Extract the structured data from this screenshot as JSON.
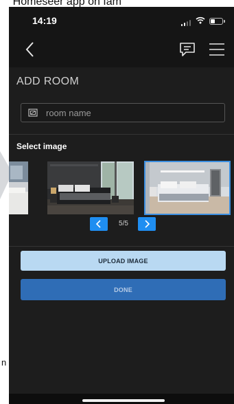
{
  "page_caption": "or Homeseer app on Iam",
  "status": {
    "time": "14:19"
  },
  "nav": {
    "back_icon": "chevron-left-icon",
    "chat_icon": "chat-bubble-icon",
    "menu_icon": "hamburger-menu-icon"
  },
  "form": {
    "title": "ADD ROOM",
    "room_name_placeholder": "room name",
    "room_icon": "image-frame-icon",
    "select_label": "Select image"
  },
  "gallery": {
    "images": [
      {
        "name": "partial-room-image"
      },
      {
        "name": "dark-bedroom-image"
      },
      {
        "name": "white-bedroom-image",
        "selected": true
      }
    ]
  },
  "pager": {
    "counter": "5/5",
    "prev_icon": "chevron-left-icon",
    "next_icon": "chevron-right-icon"
  },
  "actions": {
    "upload_label": "UPLOAD IMAGE",
    "done_label": "DONE"
  },
  "colors": {
    "background": "#1d1d1d",
    "accent_blue": "#1f8ef1",
    "upload_button": "#b9d9f2",
    "done_button": "#2f6db6"
  }
}
